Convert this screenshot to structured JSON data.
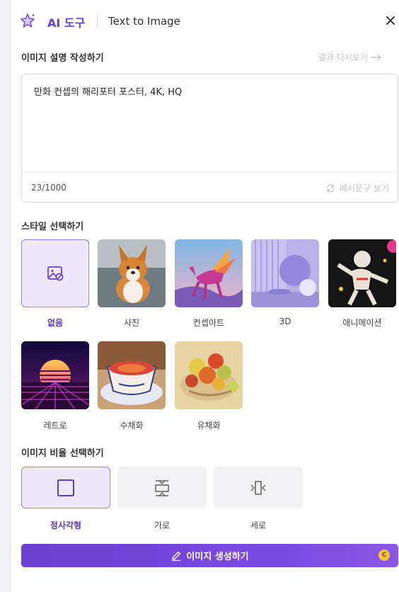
{
  "header": {
    "brand": "AI 도구",
    "subtitle": "Text to Image",
    "close_label": "×"
  },
  "prompt_section": {
    "label": "이미지 설명 작성하기",
    "history_link": "결과 다시보기",
    "prompt_value": "만화 컨셉의 해리포터 포스터, 4K, HQ",
    "char_count": "23/1000",
    "example_button": "예시문구 보기"
  },
  "style_section": {
    "label": "스타일 선택하기",
    "items": [
      {
        "label": "없음",
        "selected": true
      },
      {
        "label": "사진",
        "selected": false
      },
      {
        "label": "컨셉아트",
        "selected": false
      },
      {
        "label": "3D",
        "selected": false
      },
      {
        "label": "애니메이션",
        "selected": false
      },
      {
        "label": "레트로",
        "selected": false
      },
      {
        "label": "수채화",
        "selected": false
      },
      {
        "label": "유채화",
        "selected": false
      }
    ]
  },
  "ratio_section": {
    "label": "이미지 비율 선택하기",
    "items": [
      {
        "label": "정사각형",
        "selected": true
      },
      {
        "label": "가로",
        "selected": false
      },
      {
        "label": "세로",
        "selected": false
      }
    ]
  },
  "generate": {
    "label": "이미지 생성하기",
    "coin": "C"
  },
  "colors": {
    "accent": "#6a3fd3",
    "selected_bg": "#efe8fd",
    "selected_border": "#9d7fe8",
    "coin": "#f5c43b"
  }
}
